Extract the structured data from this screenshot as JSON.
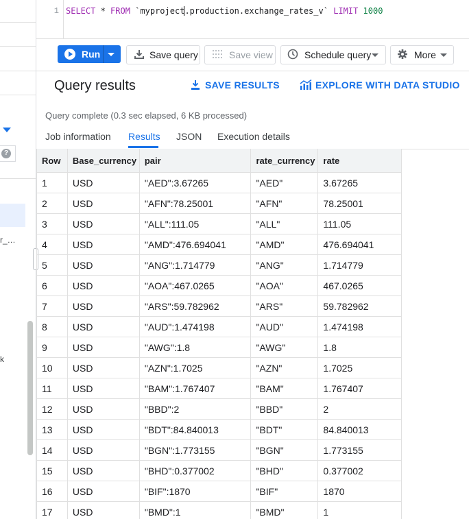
{
  "editor": {
    "line_number": "1",
    "sql": {
      "select": "SELECT",
      "star": " * ",
      "from": "FROM",
      "table_before_cursor": " `myproject",
      "table_after_cursor": ".production.exchange_rates_v` ",
      "limit": "LIMIT",
      "limit_value": " 1000"
    }
  },
  "toolbar": {
    "run_label": "Run",
    "save_query_label": "Save query",
    "save_view_label": "Save view",
    "schedule_query_label": "Schedule query",
    "more_label": "More"
  },
  "results": {
    "title": "Query results",
    "save_results_label": "SAVE RESULTS",
    "explore_label": "EXPLORE WITH DATA STUDIO",
    "status": "Query complete (0.3 sec elapsed, 6 KB processed)"
  },
  "tabs": [
    {
      "label": "Job information"
    },
    {
      "label": "Results"
    },
    {
      "label": "JSON"
    },
    {
      "label": "Execution details"
    }
  ],
  "sidebar": {
    "help_icon_label": "?",
    "truncated_item_1": "r_…",
    "truncated_item_2": "k"
  },
  "table": {
    "columns": [
      "Row",
      "Base_currency",
      "pair",
      "rate_currency",
      "rate"
    ],
    "rows": [
      [
        "1",
        "USD",
        "\"AED\":3.67265",
        "\"AED\"",
        "3.67265"
      ],
      [
        "2",
        "USD",
        "\"AFN\":78.25001",
        "\"AFN\"",
        "78.25001"
      ],
      [
        "3",
        "USD",
        "\"ALL\":111.05",
        "\"ALL\"",
        "111.05"
      ],
      [
        "4",
        "USD",
        "\"AMD\":476.694041",
        "\"AMD\"",
        "476.694041"
      ],
      [
        "5",
        "USD",
        "\"ANG\":1.714779",
        "\"ANG\"",
        "1.714779"
      ],
      [
        "6",
        "USD",
        "\"AOA\":467.0265",
        "\"AOA\"",
        "467.0265"
      ],
      [
        "7",
        "USD",
        "\"ARS\":59.782962",
        "\"ARS\"",
        "59.782962"
      ],
      [
        "8",
        "USD",
        "\"AUD\":1.474198",
        "\"AUD\"",
        "1.474198"
      ],
      [
        "9",
        "USD",
        "\"AWG\":1.8",
        "\"AWG\"",
        "1.8"
      ],
      [
        "10",
        "USD",
        "\"AZN\":1.7025",
        "\"AZN\"",
        "1.7025"
      ],
      [
        "11",
        "USD",
        "\"BAM\":1.767407",
        "\"BAM\"",
        "1.767407"
      ],
      [
        "12",
        "USD",
        "\"BBD\":2",
        "\"BBD\"",
        "2"
      ],
      [
        "13",
        "USD",
        "\"BDT\":84.840013",
        "\"BDT\"",
        "84.840013"
      ],
      [
        "14",
        "USD",
        "\"BGN\":1.773155",
        "\"BGN\"",
        "1.773155"
      ],
      [
        "15",
        "USD",
        "\"BHD\":0.377002",
        "\"BHD\"",
        "0.377002"
      ],
      [
        "16",
        "USD",
        "\"BIF\":1870",
        "\"BIF\"",
        "1870"
      ],
      [
        "17",
        "USD",
        "\"BMD\":1",
        "\"BMD\"",
        "1"
      ]
    ]
  },
  "colors": {
    "accent": "#1a73e8",
    "keyword": "#9c27b0",
    "number": "#0b8043"
  }
}
